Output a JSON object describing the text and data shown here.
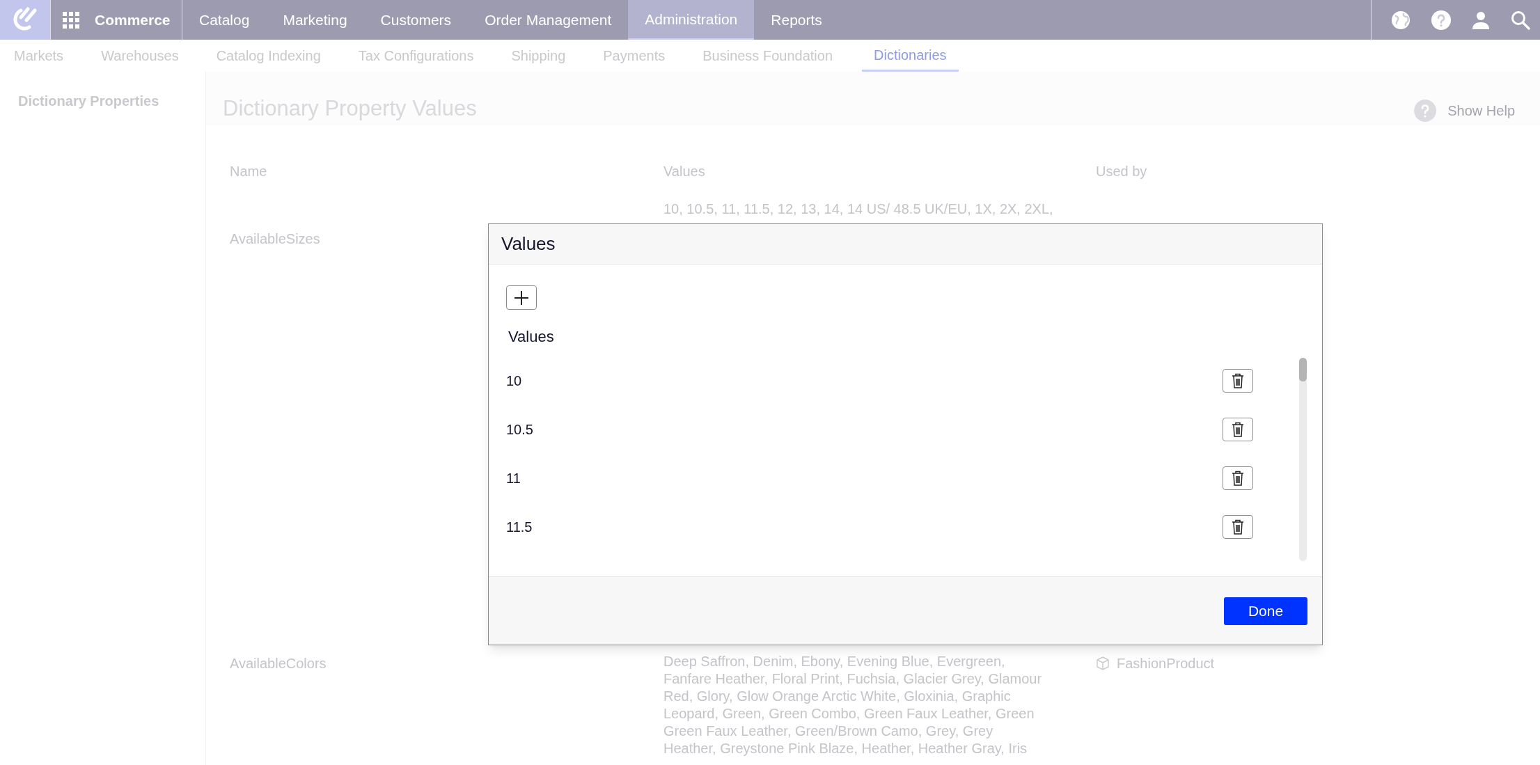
{
  "top_nav": {
    "app_name": "Commerce",
    "items": [
      {
        "label": "Catalog",
        "selected": false
      },
      {
        "label": "Marketing",
        "selected": false
      },
      {
        "label": "Customers",
        "selected": false
      },
      {
        "label": "Order Management",
        "selected": false
      },
      {
        "label": "Administration",
        "selected": true
      },
      {
        "label": "Reports",
        "selected": false
      }
    ]
  },
  "sub_nav": [
    {
      "label": "Markets",
      "selected": false
    },
    {
      "label": "Warehouses",
      "selected": false
    },
    {
      "label": "Catalog Indexing",
      "selected": false
    },
    {
      "label": "Tax Configurations",
      "selected": false
    },
    {
      "label": "Shipping",
      "selected": false
    },
    {
      "label": "Payments",
      "selected": false
    },
    {
      "label": "Business Foundation",
      "selected": false
    },
    {
      "label": "Dictionaries",
      "selected": true
    }
  ],
  "sidebar": {
    "items": [
      {
        "label": "Dictionary Properties"
      }
    ]
  },
  "page": {
    "title": "Dictionary Property Values",
    "help_link": "Show Help"
  },
  "table": {
    "columns": [
      "Name",
      "Values",
      "Used by"
    ],
    "rows": [
      {
        "name": "AvailableSizes",
        "values": "10, 10.5, 11, 11.5, 12, 13, 14, 14 US/ 48.5 UK/EU, 1X, 2X, 2XL,"
      },
      {
        "name": "AvailableColors",
        "values": "Deep Saffron, Denim, Ebony, Evening Blue, Evergreen,\nFanfare Heather, Floral Print, Fuchsia, Glacier Grey, Glamour\nRed, Glory, Glow Orange Arctic White, Gloxinia, Graphic\nLeopard, Green, Green Combo, Green Faux Leather, Green\nGreen Faux Leather, Green/Brown Camo, Grey, Grey\nHeather, Greystone Pink Blaze, Heather, Heather Gray, Iris",
        "used_by": "FashionProduct"
      }
    ]
  },
  "dialog": {
    "title": "Values",
    "list_header": "Values",
    "values": [
      "10",
      "10.5",
      "11",
      "11.5"
    ],
    "done_button": "Done"
  }
}
